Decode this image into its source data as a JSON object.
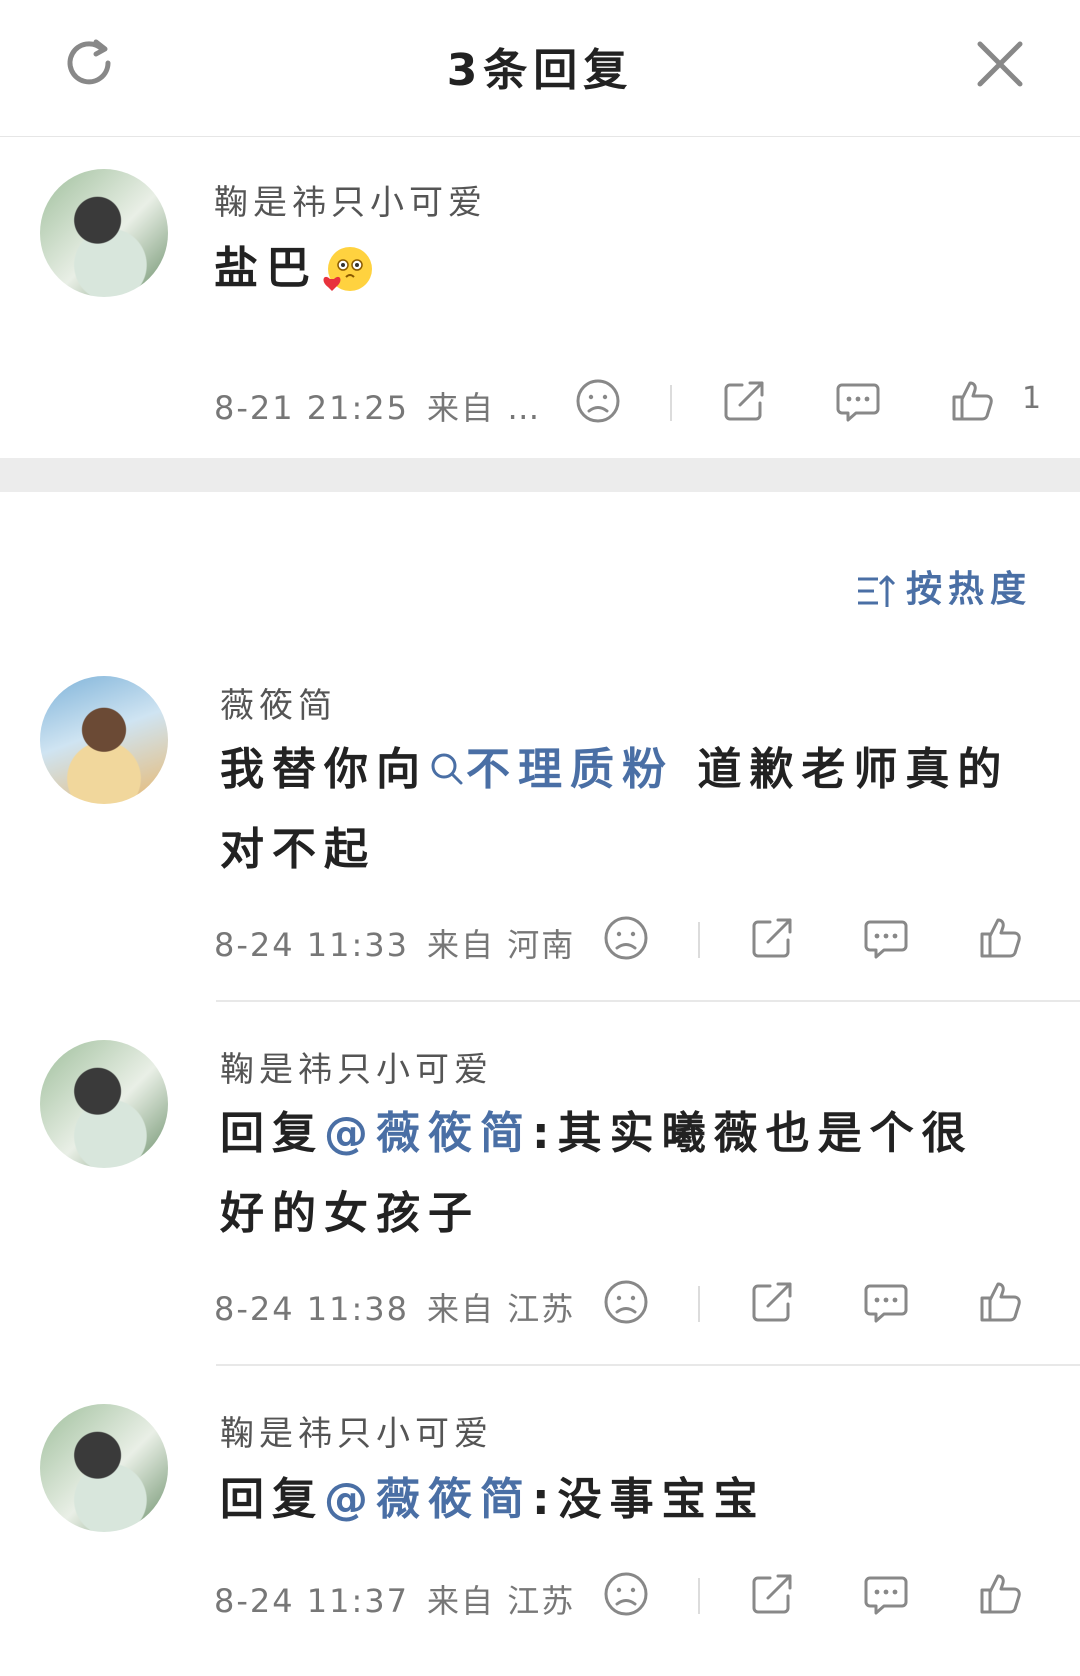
{
  "header": {
    "title": "3条回复"
  },
  "root": {
    "username": "鞠是祎只小可爱",
    "text": "盐巴",
    "time": "8-21 21:25",
    "location": "来自 …",
    "likes": "1"
  },
  "sort": {
    "label": "按热度"
  },
  "replies": [
    {
      "username": "薇筱简",
      "text_before": "我替你向",
      "link": "不理质粉",
      "text_after": " 道歉老师真的对不起",
      "time": "8-24 11:33",
      "location": "来自 河南"
    },
    {
      "username": "鞠是祎只小可爱",
      "text_before": "回复",
      "link": "@薇筱简",
      "text_after": ":其实曦薇也是个很好的女孩子",
      "time": "8-24 11:38",
      "location": "来自 江苏"
    },
    {
      "username": "鞠是祎只小可爱",
      "text_before": "回复",
      "link": "@薇筱简",
      "text_after": ":没事宝宝",
      "time": "8-24 11:37",
      "location": "来自 江苏"
    }
  ],
  "colors": {
    "link": "#4a6fa5",
    "separator": "#ececec"
  }
}
